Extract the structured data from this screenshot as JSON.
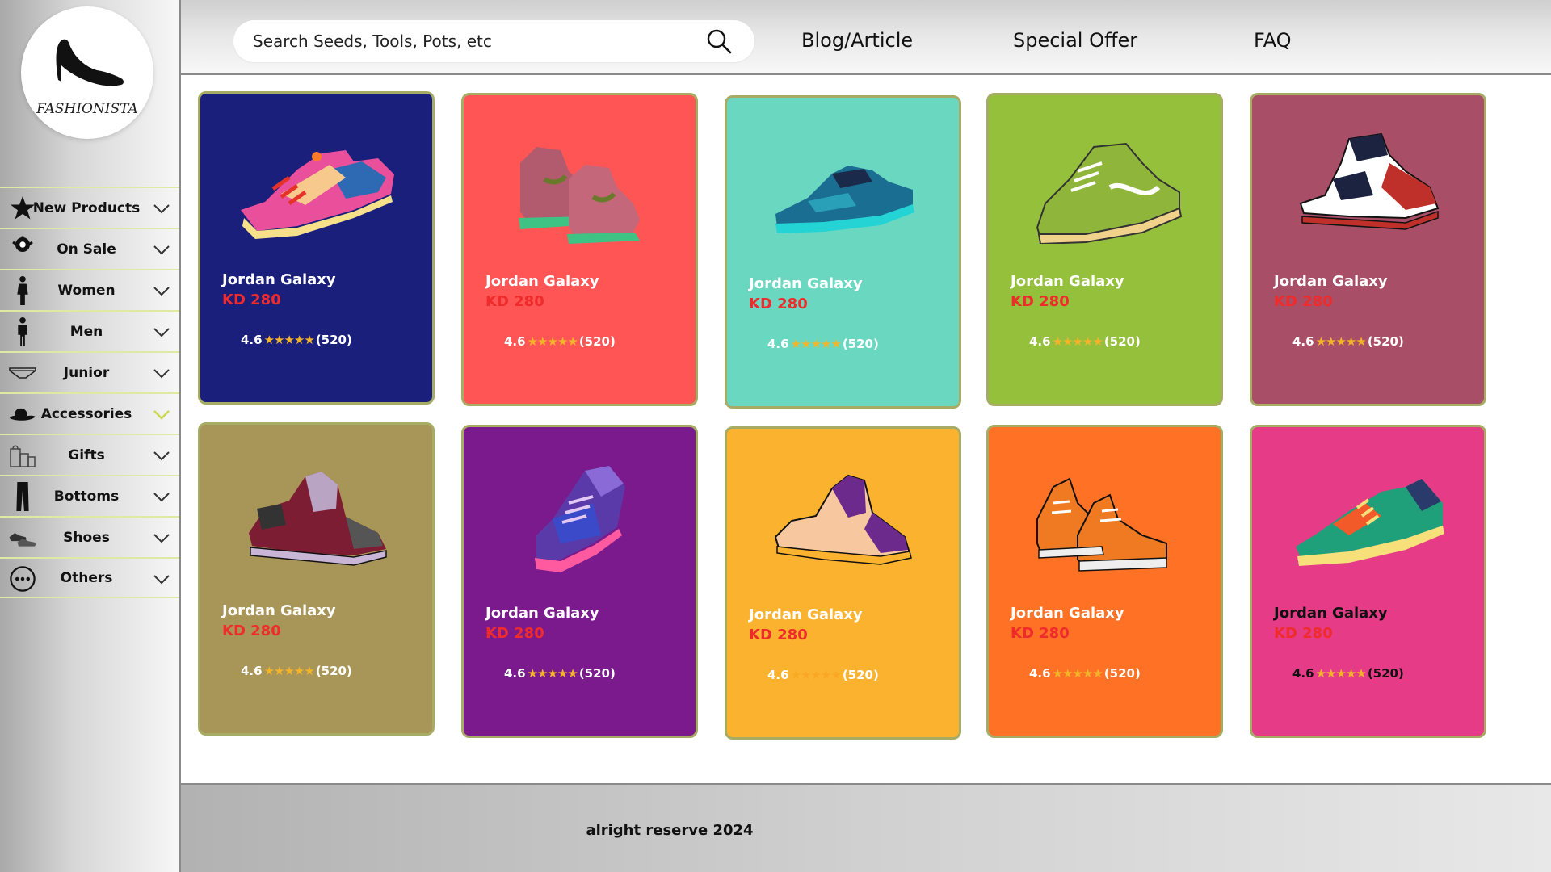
{
  "brand": {
    "name": "FASHIONISTA"
  },
  "header": {
    "search_placeholder": "Search Seeds, Tools, Pots, etc",
    "nav": [
      "Blog/Article",
      "Special Offer",
      "FAQ"
    ]
  },
  "sidebar": {
    "items": [
      {
        "label": "New Products",
        "icon": "star-icon"
      },
      {
        "label": "On Sale",
        "icon": "sale-badge-icon"
      },
      {
        "label": "Women",
        "icon": "woman-icon"
      },
      {
        "label": "Men",
        "icon": "man-icon"
      },
      {
        "label": "Junior",
        "icon": "underwear-icon"
      },
      {
        "label": "Accessories",
        "icon": "hat-icon",
        "active": true
      },
      {
        "label": "Gifts",
        "icon": "gift-bags-icon"
      },
      {
        "label": "Bottoms",
        "icon": "pants-icon"
      },
      {
        "label": "Shoes",
        "icon": "shoes-icon"
      },
      {
        "label": "Others",
        "icon": "more-icon"
      }
    ]
  },
  "products": [
    {
      "name": "Jordan Galaxy",
      "price": "KD 280",
      "rating": "4.6",
      "stars": "★★★★★",
      "reviews": "(520)",
      "bg": "#1a1f7c",
      "shoe": "low-sneaker"
    },
    {
      "name": "Jordan Galaxy",
      "price": "KD 280",
      "rating": "4.6",
      "stars": "★★★★★",
      "reviews": "(520)",
      "bg": "#ff5555",
      "shoe": "pair-sneakers"
    },
    {
      "name": "Jordan Galaxy",
      "price": "KD 280",
      "rating": "4.6",
      "stars": "★★★★★",
      "reviews": "(520)",
      "bg": "#6ad8c0",
      "shoe": "teal-sneaker"
    },
    {
      "name": "Jordan Galaxy",
      "price": "KD 280",
      "rating": "4.6",
      "stars": "★★★★★",
      "reviews": "(520)",
      "bg": "#94c03c",
      "shoe": "green-sneaker"
    },
    {
      "name": "Jordan Galaxy",
      "price": "KD 280",
      "rating": "4.6",
      "stars": "★★★★★",
      "reviews": "(520)",
      "bg": "#a84e66",
      "shoe": "high-top"
    },
    {
      "name": "Jordan Galaxy",
      "price": "KD 280",
      "rating": "4.6",
      "stars": "★★★★★",
      "reviews": "(520)",
      "bg": "#a89558",
      "shoe": "maroon-high-top"
    },
    {
      "name": "Jordan Galaxy",
      "price": "KD 280",
      "rating": "4.6",
      "stars": "★★★★★",
      "reviews": "(520)",
      "bg": "#7a1a8c",
      "shoe": "purple-high-top"
    },
    {
      "name": "Jordan Galaxy",
      "price": "KD 280",
      "rating": "4.6",
      "stars": "★★★★★",
      "reviews": "(520)",
      "bg": "#fbb22e",
      "shoe": "yellow-high-top"
    },
    {
      "name": "Jordan Galaxy",
      "price": "KD 280",
      "rating": "4.6",
      "stars": "★★★★★",
      "reviews": "(520)",
      "bg": "#ff7125",
      "shoe": "converse-pair"
    },
    {
      "name": "Jordan Galaxy",
      "price": "KD 280",
      "rating": "4.6",
      "stars": "★★★★★",
      "reviews": "(520)",
      "bg": "#e63b86",
      "shoe": "green-runner"
    }
  ],
  "footer": {
    "text": "alright reserve 2024"
  },
  "colors": {
    "accent_border": "#a6ac63",
    "price": "#ef2b2b",
    "star": "#f4b42a",
    "menu_divider": "#dfe9a4",
    "active_chevron": "#c9d94a"
  }
}
